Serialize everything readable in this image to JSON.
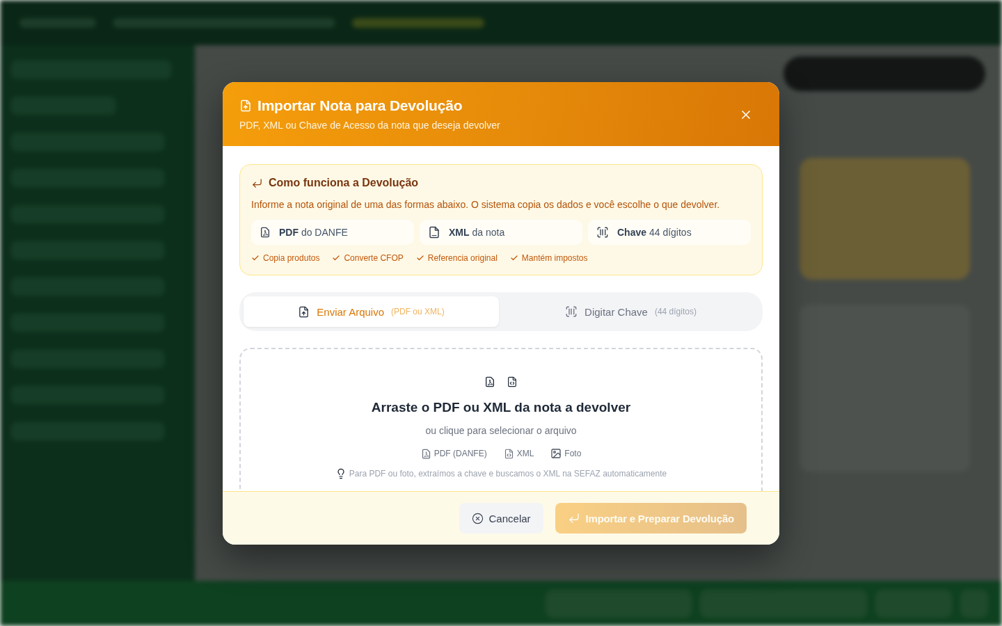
{
  "dialog": {
    "title": "Importar Nota para Devolução",
    "subtitle": "PDF, XML ou Chave de Acesso da nota que deseja devolver"
  },
  "info": {
    "title": "Como funciona a Devolução",
    "text": "Informe a nota original de uma das formas abaixo. O sistema copia os dados e você escolhe o que devolver.",
    "methods": [
      {
        "kind": "pdf",
        "label": "**PDF** do DANFE"
      },
      {
        "kind": "xml",
        "label": "**XML** da nota"
      },
      {
        "kind": "key",
        "label": "**Chave** 44 dígitos"
      }
    ],
    "features": [
      "Copia produtos",
      "Converte CFOP",
      "Referencia original",
      "Mantém impostos"
    ]
  },
  "tabs": [
    {
      "kind": "file",
      "label": "Enviar Arquivo",
      "hint": "(PDF ou XML)",
      "selected": true
    },
    {
      "kind": "key",
      "label": "Digitar Chave",
      "hint": "(44 dígitos)",
      "selected": false
    }
  ],
  "dropzone": {
    "title": "Arraste o PDF ou XML da nota a devolver",
    "subtitle": "ou clique para selecionar o arquivo",
    "formats": [
      {
        "kind": "pdf",
        "label": "PDF (DANFE)"
      },
      {
        "kind": "xml",
        "label": "XML"
      },
      {
        "kind": "photo",
        "label": "Foto"
      }
    ],
    "hint": "Para PDF ou foto, extraímos a chave e buscamos o XML na SEFAZ automaticamente"
  },
  "buttons": [
    {
      "kind": "cancel",
      "label": "Cancelar",
      "disabled": false
    },
    {
      "kind": "import",
      "label": "Importar e Preparar Devolução",
      "disabled": true
    }
  ]
}
